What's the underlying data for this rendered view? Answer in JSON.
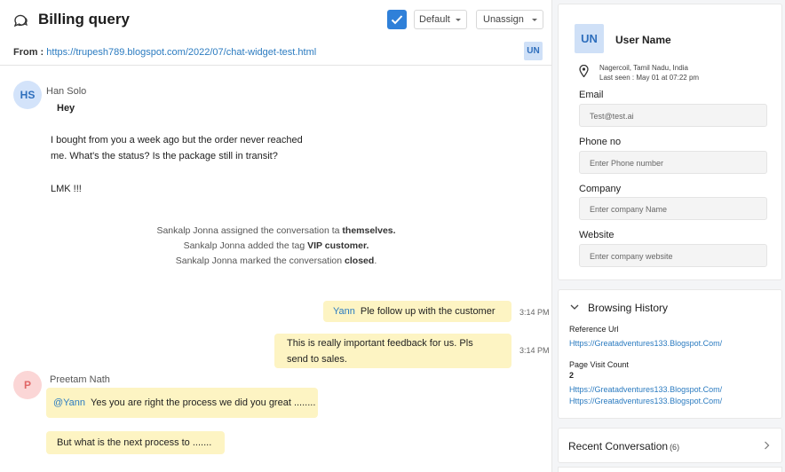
{
  "conversation": {
    "title": "Billing query",
    "default_label": "Default",
    "assign_label": "Unassign",
    "from_label": "From :",
    "from_url": "https://trupesh789.blogspot.com/2022/07/chat-widget-test.html",
    "user_badge": "UN"
  },
  "messages": {
    "customer_initials": "HS",
    "customer_name": "Han Solo",
    "hey": "Hey",
    "line1": "I bought from you a week ago but the order never reached",
    "line2": "me. What's the status? Is the package still in transit?",
    "line3": "LMK !!!",
    "system1_pre": "Sankalp Jonna assigned the conversation ta ",
    "system1_bold": "themselves.",
    "system2_pre": "Sankalp Jonna added the tag ",
    "system2_bold": "VIP customer.",
    "system3_pre": "Sankalp Jonna marked the conversation ",
    "system3_bold": "closed",
    "system3_post": ".",
    "agent_reply1_mention": "Yann",
    "agent_reply1_text": "Ple follow up with the customer",
    "agent_reply1_time": "3:14 PM",
    "agent_reply2_line1": "This is really important feedback for us. Pls",
    "agent_reply2_line2": "send to sales.",
    "agent_reply2_time": "3:14 PM",
    "p_initial": "P",
    "p_name": "Preetam Nath",
    "p_msg1_mention": "@Yann",
    "p_msg1_text": "Yes you are right the process we did you great ........",
    "p_msg2_text": "But what is the next process to ......."
  },
  "profile": {
    "initials": "UN",
    "name": "User Name",
    "location": "Nagercoil, Tamil Nadu, India",
    "last_seen": "Last seen : May 01 at 07:22 pm",
    "email_label": "Email",
    "email_value": "Test@test.ai",
    "phone_label": "Phone no",
    "phone_placeholder": "Enter Phone number",
    "company_label": "Company",
    "company_placeholder": "Enter company Name",
    "website_label": "Website",
    "website_placeholder": "Enter company website"
  },
  "browsing": {
    "title": "Browsing History",
    "ref_label": "Reference Url",
    "ref_url": "Https://Greatadventures133.Blogspot.Com/",
    "count_label": "Page Visit Count",
    "count_value": "2",
    "visited": [
      "Https://Greatadventures133.Blogspot.Com/",
      "Https://Greatadventures133.Blogspot.Com/"
    ]
  },
  "recent": {
    "title": "Recent Conversation",
    "count": "(6)"
  },
  "colors": {
    "accent": "#2f80d9",
    "bubble": "#fdf4c3",
    "link": "#2b7bc0"
  }
}
